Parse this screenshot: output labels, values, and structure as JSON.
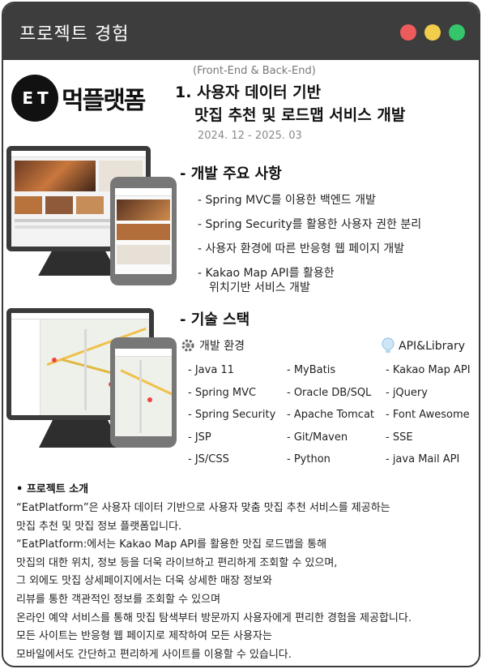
{
  "window": {
    "title": "프로젝트 경험",
    "controls": [
      "close-dot",
      "minimize-dot",
      "maximize-dot"
    ],
    "colors": {
      "red": "#ee5b5b",
      "yellow": "#f2cd4c",
      "green": "#35c56a",
      "titlebar": "#3d3d3d"
    }
  },
  "logo": {
    "mark": "E T",
    "text": "먹플랫폼"
  },
  "project": {
    "tag": "(Front-End & Back-End)",
    "title_line1": "1. 사용자 데이터 기반",
    "title_line2": "맛집 추천 및 로드맵 서비스 개발",
    "period": "2024. 12 - 2025. 03"
  },
  "dev_section": {
    "heading": "- 개발 주요 사항",
    "items": [
      {
        "line1": "- Spring MVC를 이용한 백엔드 개발"
      },
      {
        "line1": "- Spring Security를 활용한 사용자 권한 분리"
      },
      {
        "line1": "- 사용자 환경에 따른 반응형 웹 페이지 개발"
      },
      {
        "line1": "- Kakao Map API를 활용한",
        "line2": "위치기반 서비스 개발"
      }
    ]
  },
  "tech_section": {
    "heading": "- 기술 스택",
    "env_label": "개발 환경",
    "api_label": "API&Library",
    "col1": [
      "- Java 11",
      "- Spring MVC",
      "- Spring Security",
      "- JSP",
      "- JS/CSS"
    ],
    "col2": [
      "- MyBatis",
      "- Oracle DB/SQL",
      "- Apache Tomcat",
      "- Git/Maven",
      "- Python"
    ],
    "col3": [
      "- Kakao Map API",
      "- jQuery",
      "- Font Awesome",
      "- SSE",
      "- java Mail API"
    ]
  },
  "intro": {
    "heading": "• 프로젝트 소개",
    "lines": [
      "“EatPlatform”은 사용자 데이터 기반으로 사용자 맞춤 맛집 추천 서비스를 제공하는",
      "맛집 추천 및 맛집 정보 플랫폼입니다.",
      "“EatPlatform:에서는 Kakao Map API를 활용한 맛집 로드맵을 통해",
      "맛집의 대한 위치, 정보 등을 더욱 라이브하고 편리하게 조회할 수 있으며,",
      "그 외에도 맛집 상세페이지에서는 더욱 상세한 매장 정보와",
      "리뷰를 통한 객관적인 정보를 조회할 수 있으며",
      "온라인 예약 서비스를 통해 맛집 탐색부터 방문까지 사용자에게 편리한 경험을 제공합니다.",
      "모든 사이트는 반응형 웹 페이지로 제작하여 모든 사용자는",
      "모바일에서도 간단하고 편리하게 사이트를 이용할 수 있습니다."
    ]
  }
}
